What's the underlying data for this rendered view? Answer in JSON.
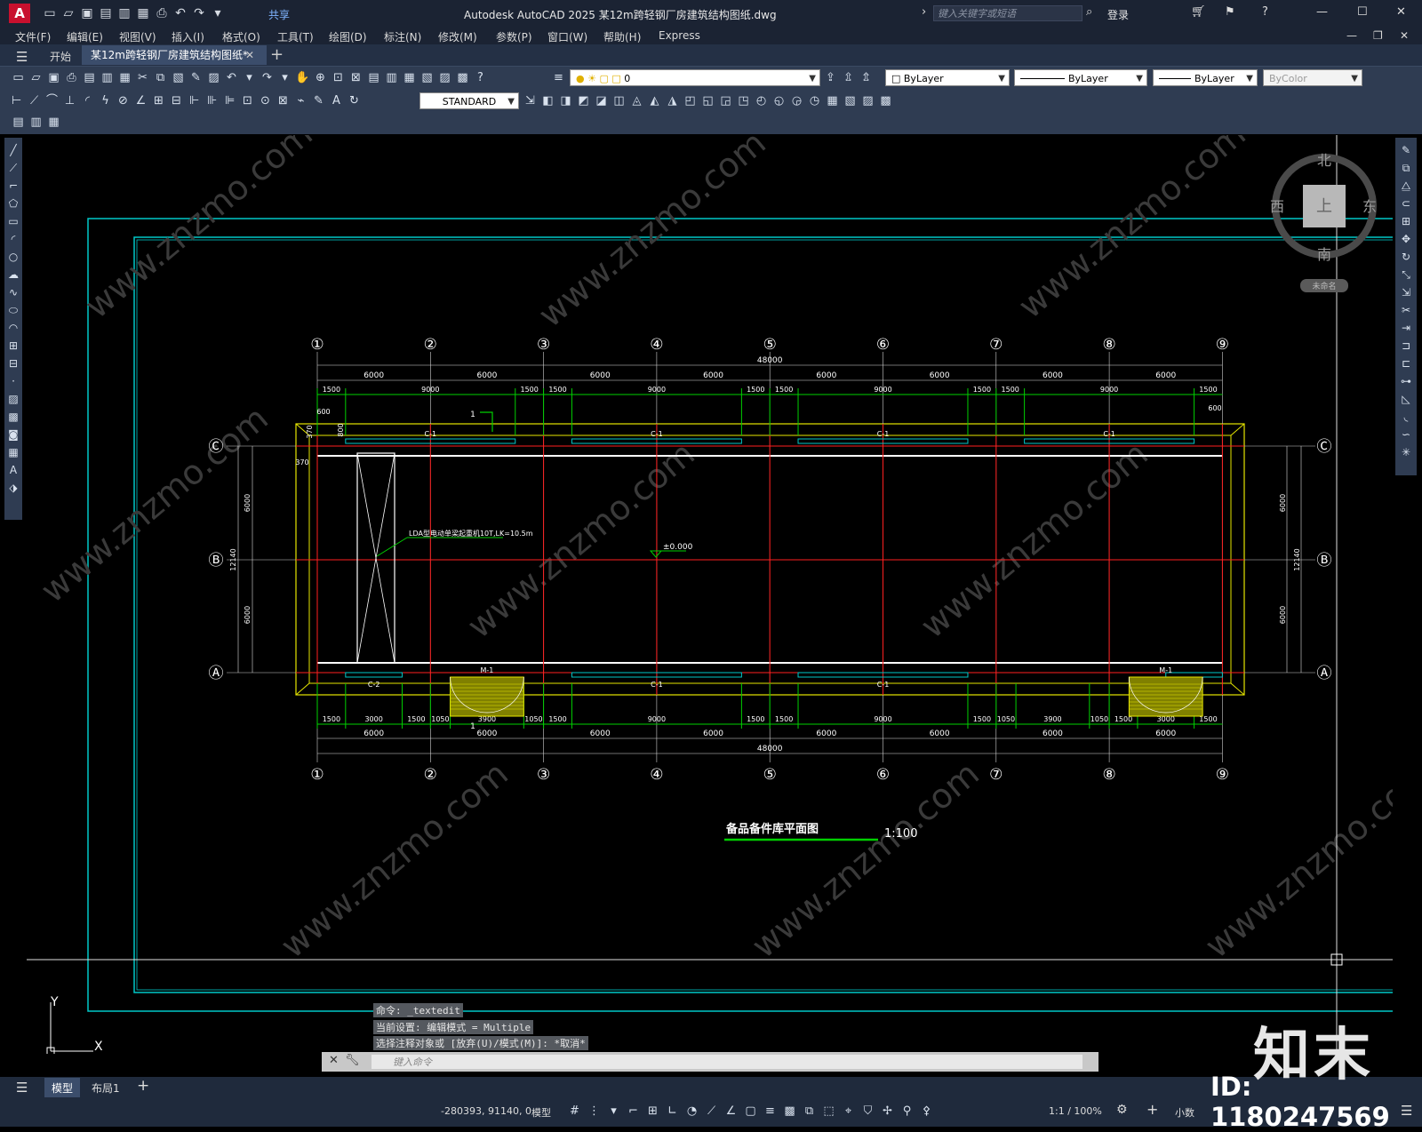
{
  "app": {
    "logo": "A",
    "title": "Autodesk AutoCAD 2025    某12m跨轻钢厂房建筑结构图纸.dwg",
    "share": "共享",
    "search_placeholder": "键入关键字或短语",
    "login": "登录"
  },
  "menu": [
    "文件(F)",
    "编辑(E)",
    "视图(V)",
    "插入(I)",
    "格式(O)",
    "工具(T)",
    "绘图(D)",
    "标注(N)",
    "修改(M)",
    "参数(P)",
    "窗口(W)",
    "帮助(H)",
    "Express"
  ],
  "tabs": {
    "start": "开始",
    "file": "某12m跨轻钢厂房建筑结构图纸*"
  },
  "toolbar": {
    "layer": "0",
    "color": "ByLayer",
    "linetype": "ByLayer",
    "lineweight": "ByLayer",
    "plotstyle": "ByColor",
    "textstyle": "STANDARD"
  },
  "viewcube": {
    "north": "北",
    "south": "南",
    "east": "东",
    "west": "西",
    "top": "上",
    "ucs": "未命名"
  },
  "drawing": {
    "grid_cols": [
      "①",
      "②",
      "③",
      "④",
      "⑤",
      "⑥",
      "⑦",
      "⑧",
      "⑨"
    ],
    "grid_rows": [
      "Ⓒ",
      "Ⓑ",
      "Ⓐ"
    ],
    "span": "6000",
    "total": "48000",
    "top_sub": [
      "1500",
      "9000",
      "1500",
      "1500",
      "9000",
      "1500",
      "1500",
      "9000",
      "1500",
      "1500",
      "9000",
      "1500"
    ],
    "bot_sub": [
      "1500",
      "3000",
      "1500",
      "1050",
      "3900",
      "1050",
      "1500",
      "9000",
      "1500",
      "1500",
      "9000",
      "1500",
      "1050",
      "3900",
      "1050",
      "1500",
      "3000",
      "1500"
    ],
    "dims_side": [
      "6000",
      "6000",
      "12140"
    ],
    "small_dims": [
      "600",
      "370",
      "800",
      "370",
      "600"
    ],
    "window_c1": "C-1",
    "window_c2": "C-2",
    "door": "M-1",
    "elevation": "±0.000",
    "crane_note": "LDA型电动单梁起重机10T,LK=10.5m",
    "section_mark": "1",
    "title": "备品备件库平面图",
    "scale": "1:100"
  },
  "command": {
    "history": [
      "命令: _textedit",
      "当前设置: 编辑模式 = Multiple",
      "选择注释对象或 [放弃(U)/模式(M)]: *取消*"
    ],
    "placeholder": "键入命令"
  },
  "layout_tabs": [
    "模型",
    "布局1"
  ],
  "status": {
    "coords": "-280393, 91140, 0",
    "model": "模型",
    "scale": "1:1 / 100%",
    "units": "小数"
  },
  "watermark": {
    "brand": "知末",
    "id": "ID: 1180247569",
    "url": "www.znzmo.com"
  },
  "ucs": {
    "x": "X",
    "y": "Y"
  }
}
